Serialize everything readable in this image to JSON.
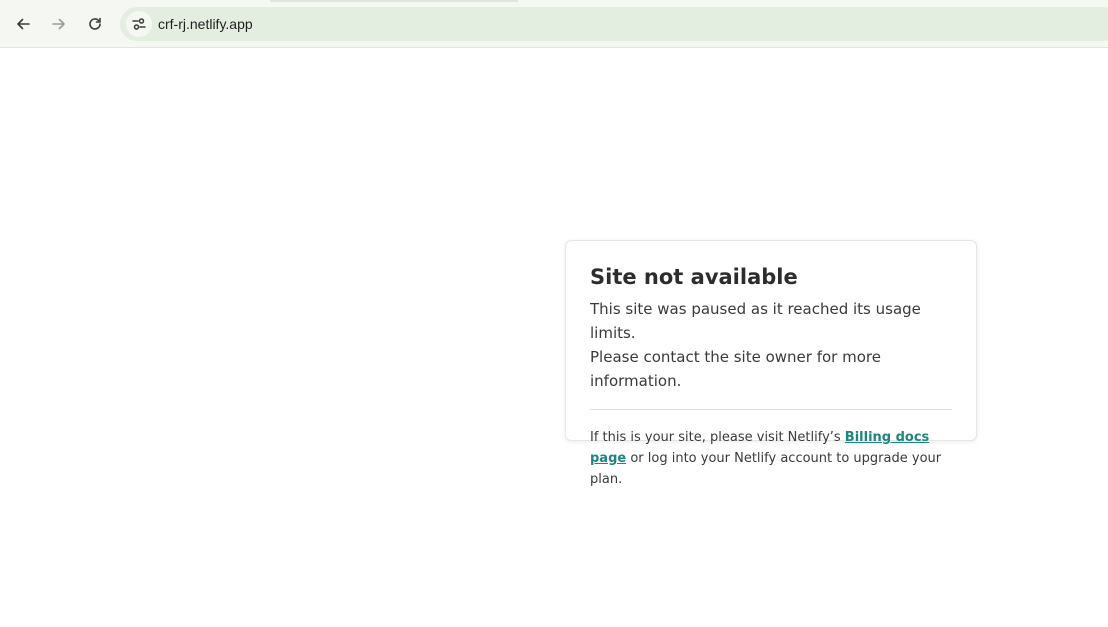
{
  "browser": {
    "url": "crf-rj.netlify.app",
    "icons": {
      "back": "arrow-left-icon",
      "forward": "arrow-right-icon",
      "reload": "reload-icon",
      "site_info": "tune-icon"
    }
  },
  "notice": {
    "title": "Site not available",
    "message_line1": "This site was paused as it reached its usage limits.",
    "message_line2": "Please contact the site owner for more information.",
    "note_before_link": "If this is your site, please visit Netlify’s ",
    "link_text": "Billing docs page",
    "note_after_link": " or log into your Netlify account to upgrade your plan.",
    "link_color": "#1f8580"
  }
}
